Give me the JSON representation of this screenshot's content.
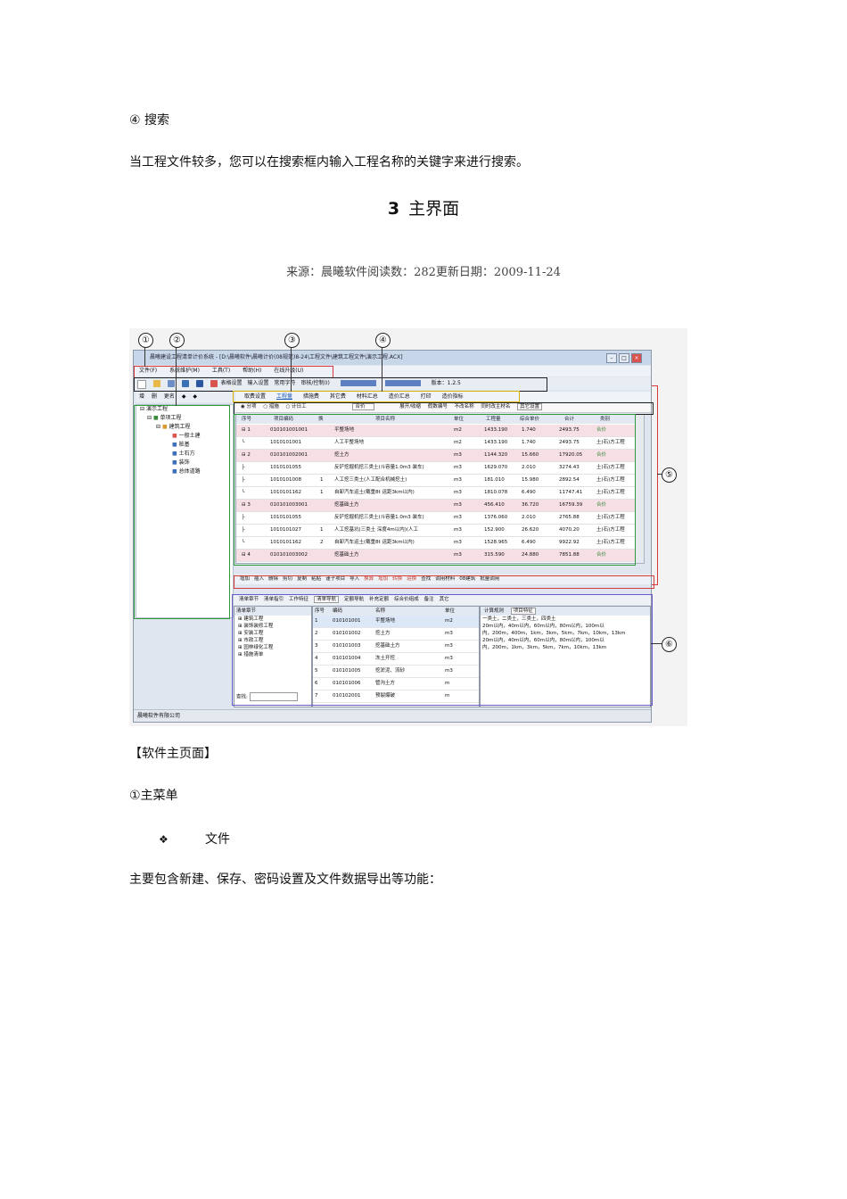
{
  "doc": {
    "search_heading": "④ 搜索",
    "search_desc": "当工程文件较多，您可以在搜索框内输入工程名称的关键字来进行搜索。",
    "section_number": "3",
    "section_title": "主界面",
    "source_line": "来源：晨曦软件阅读数：282更新日期：2009-11-24",
    "caption": "【软件主页面】",
    "main_menu_label": "①主菜单",
    "bullet_symbol": "❖",
    "bullet_text": "文件",
    "file_desc": "主要包含新建、保存、密码设置及文件数据导出等功能："
  },
  "screenshot": {
    "callouts": [
      "①",
      "②",
      "③",
      "④",
      "⑤",
      "⑥"
    ],
    "title_bar": "晨曦建设工程清单计价系统 - [D:\\晨曦软件\\晨曦计价(08规范)8-24\\工程文件\\建筑工程文件\\演示工程.ACX]",
    "menu": [
      "文件(F)",
      "系统维护(M)",
      "工具(T)",
      "帮助(H)",
      "在线升级(U)"
    ],
    "toolbar": [
      "表格设置",
      "输入设置",
      "常用字符",
      "审核/控制(I)"
    ],
    "version": "版本：1.2.5",
    "left_toolbar": [
      "增",
      "删",
      "更名",
      "◆",
      "◆"
    ],
    "tree": [
      "演示工程",
      "单项工程",
      "建筑工程",
      "一般土建",
      "桩基",
      "土石方",
      "装饰",
      "总体道路"
    ],
    "tabs": [
      "取费设置",
      "工程量",
      "措施费",
      "其它费",
      "材料汇总",
      "造价汇总",
      "打印",
      "造价指标"
    ],
    "filter": [
      "◉ 分项",
      "○ 措施",
      "○ 计日工",
      "合价",
      "展开/收缩",
      "假数编号",
      "不改名称",
      "同时改主材名",
      "其它设置"
    ],
    "grid_headers": [
      "序号",
      "项目编码",
      "换",
      "项目名称",
      "单位",
      "工程量",
      "综合单价",
      "合计",
      "类别"
    ],
    "grid_rows": [
      {
        "no": "⊟ 1",
        "code": "010101001001",
        "h": "",
        "name": "平整场地",
        "unit": "m2",
        "qty": "1433.190",
        "price": "1.740",
        "total": "2493.75",
        "cat": "合价",
        "hl": true
      },
      {
        "no": "└",
        "code": "1010101001",
        "h": "",
        "name": "人工平整场地",
        "unit": "m2",
        "qty": "1433.190",
        "price": "1.740",
        "total": "2493.75",
        "cat": "土(石)方工程",
        "hl": false
      },
      {
        "no": "⊟ 2",
        "code": "010101002001",
        "h": "",
        "name": "挖土方",
        "unit": "m3",
        "qty": "1144.320",
        "price": "15.660",
        "total": "17920.05",
        "cat": "合价",
        "hl": true
      },
      {
        "no": "├",
        "code": "1010101055",
        "h": "",
        "name": "反铲挖掘机挖三类土(斗容量1.0m3 装车)",
        "unit": "m3",
        "qty": "1629.070",
        "price": "2.010",
        "total": "3274.43",
        "cat": "土(石)方工程",
        "hl": false
      },
      {
        "no": "├",
        "code": "1010101008",
        "h": "1",
        "name": "人工挖三类土(人工配合机械挖土)",
        "unit": "m3",
        "qty": "181.010",
        "price": "15.980",
        "total": "2892.54",
        "cat": "土(石)方工程",
        "hl": false
      },
      {
        "no": "└",
        "code": "1010101162",
        "h": "1",
        "name": "自卸汽车运土(载重8t 运距3km以内)",
        "unit": "m3",
        "qty": "1810.078",
        "price": "6.490",
        "total": "11747.41",
        "cat": "土(石)方工程",
        "hl": false
      },
      {
        "no": "⊟ 3",
        "code": "010101003001",
        "h": "",
        "name": "挖基础土方",
        "unit": "m3",
        "qty": "456.410",
        "price": "36.720",
        "total": "16759.39",
        "cat": "合价",
        "hl": true
      },
      {
        "no": "├",
        "code": "1010101055",
        "h": "",
        "name": "反铲挖掘机挖三类土(斗容量1.0m3 装车)",
        "unit": "m3",
        "qty": "1376.060",
        "price": "2.010",
        "total": "2765.88",
        "cat": "土(石)方工程",
        "hl": false
      },
      {
        "no": "├",
        "code": "1010101027",
        "h": "1",
        "name": "人工挖基坑(三类土 深度4m以内)(人工",
        "unit": "m3",
        "qty": "152.900",
        "price": "26.620",
        "total": "4070.20",
        "cat": "土(石)方工程",
        "hl": false
      },
      {
        "no": "└",
        "code": "1010101162",
        "h": "2",
        "name": "自卸汽车运土(载重8t 运距3km以内)",
        "unit": "m3",
        "qty": "1528.965",
        "price": "6.490",
        "total": "9922.92",
        "cat": "土(石)方工程",
        "hl": false
      },
      {
        "no": "⊟ 4",
        "code": "010101003002",
        "h": "",
        "name": "挖基础土方",
        "unit": "m3",
        "qty": "315.590",
        "price": "24.880",
        "total": "7851.88",
        "cat": "合价",
        "hl": true
      }
    ],
    "action_bar": [
      "增加",
      "插入",
      "删除",
      "剪切",
      "复制",
      "粘贴",
      "谨子项目",
      "导入",
      "换算",
      "增加",
      "转换",
      "运换",
      "查找",
      "调用材料",
      "08建筑",
      "批量调用"
    ],
    "bottom_tabs": [
      "清单章节",
      "清单指引",
      "工作特征",
      "清单导航",
      "定额导航",
      "补充定额",
      "综合价组成",
      "备注",
      "其它"
    ],
    "chapter_title": "清单章节",
    "chapters": [
      "建筑工程",
      "装饰装修工程",
      "安装工程",
      "市政工程",
      "园林绿化工程",
      "措施清单"
    ],
    "search_label": "查找:",
    "list_headers": [
      "序号",
      "编码",
      "名称",
      "单位"
    ],
    "list_rows": [
      {
        "no": "1",
        "code": "010101001",
        "name": "平整场地",
        "unit": "m2"
      },
      {
        "no": "2",
        "code": "010101002",
        "name": "挖土方",
        "unit": "m3"
      },
      {
        "no": "3",
        "code": "010101003",
        "name": "挖基础土方",
        "unit": "m3"
      },
      {
        "no": "4",
        "code": "010101004",
        "name": "冻土开挖",
        "unit": "m3"
      },
      {
        "no": "5",
        "code": "010101005",
        "name": "挖淤泥、流砂",
        "unit": "m3"
      },
      {
        "no": "6",
        "code": "010101006",
        "name": "管沟土方",
        "unit": "m"
      },
      {
        "no": "7",
        "code": "010102001",
        "name": "预裂爆破",
        "unit": "m"
      }
    ],
    "right_tabs": [
      "计算规则",
      "项目特征"
    ],
    "features": [
      "一类土，二类土，三类土，四类土",
      "20m以内，40m以内，60m以内，80m以内，100m以",
      "内，200m，400m，1km，3km，5km，7km，10km，13km",
      "20m以内，40m以内，60m以内，80m以内，100m以",
      "内，200m，1km，3km，5km，7km，10km，13km"
    ],
    "status": "晨曦软件有限公司"
  }
}
